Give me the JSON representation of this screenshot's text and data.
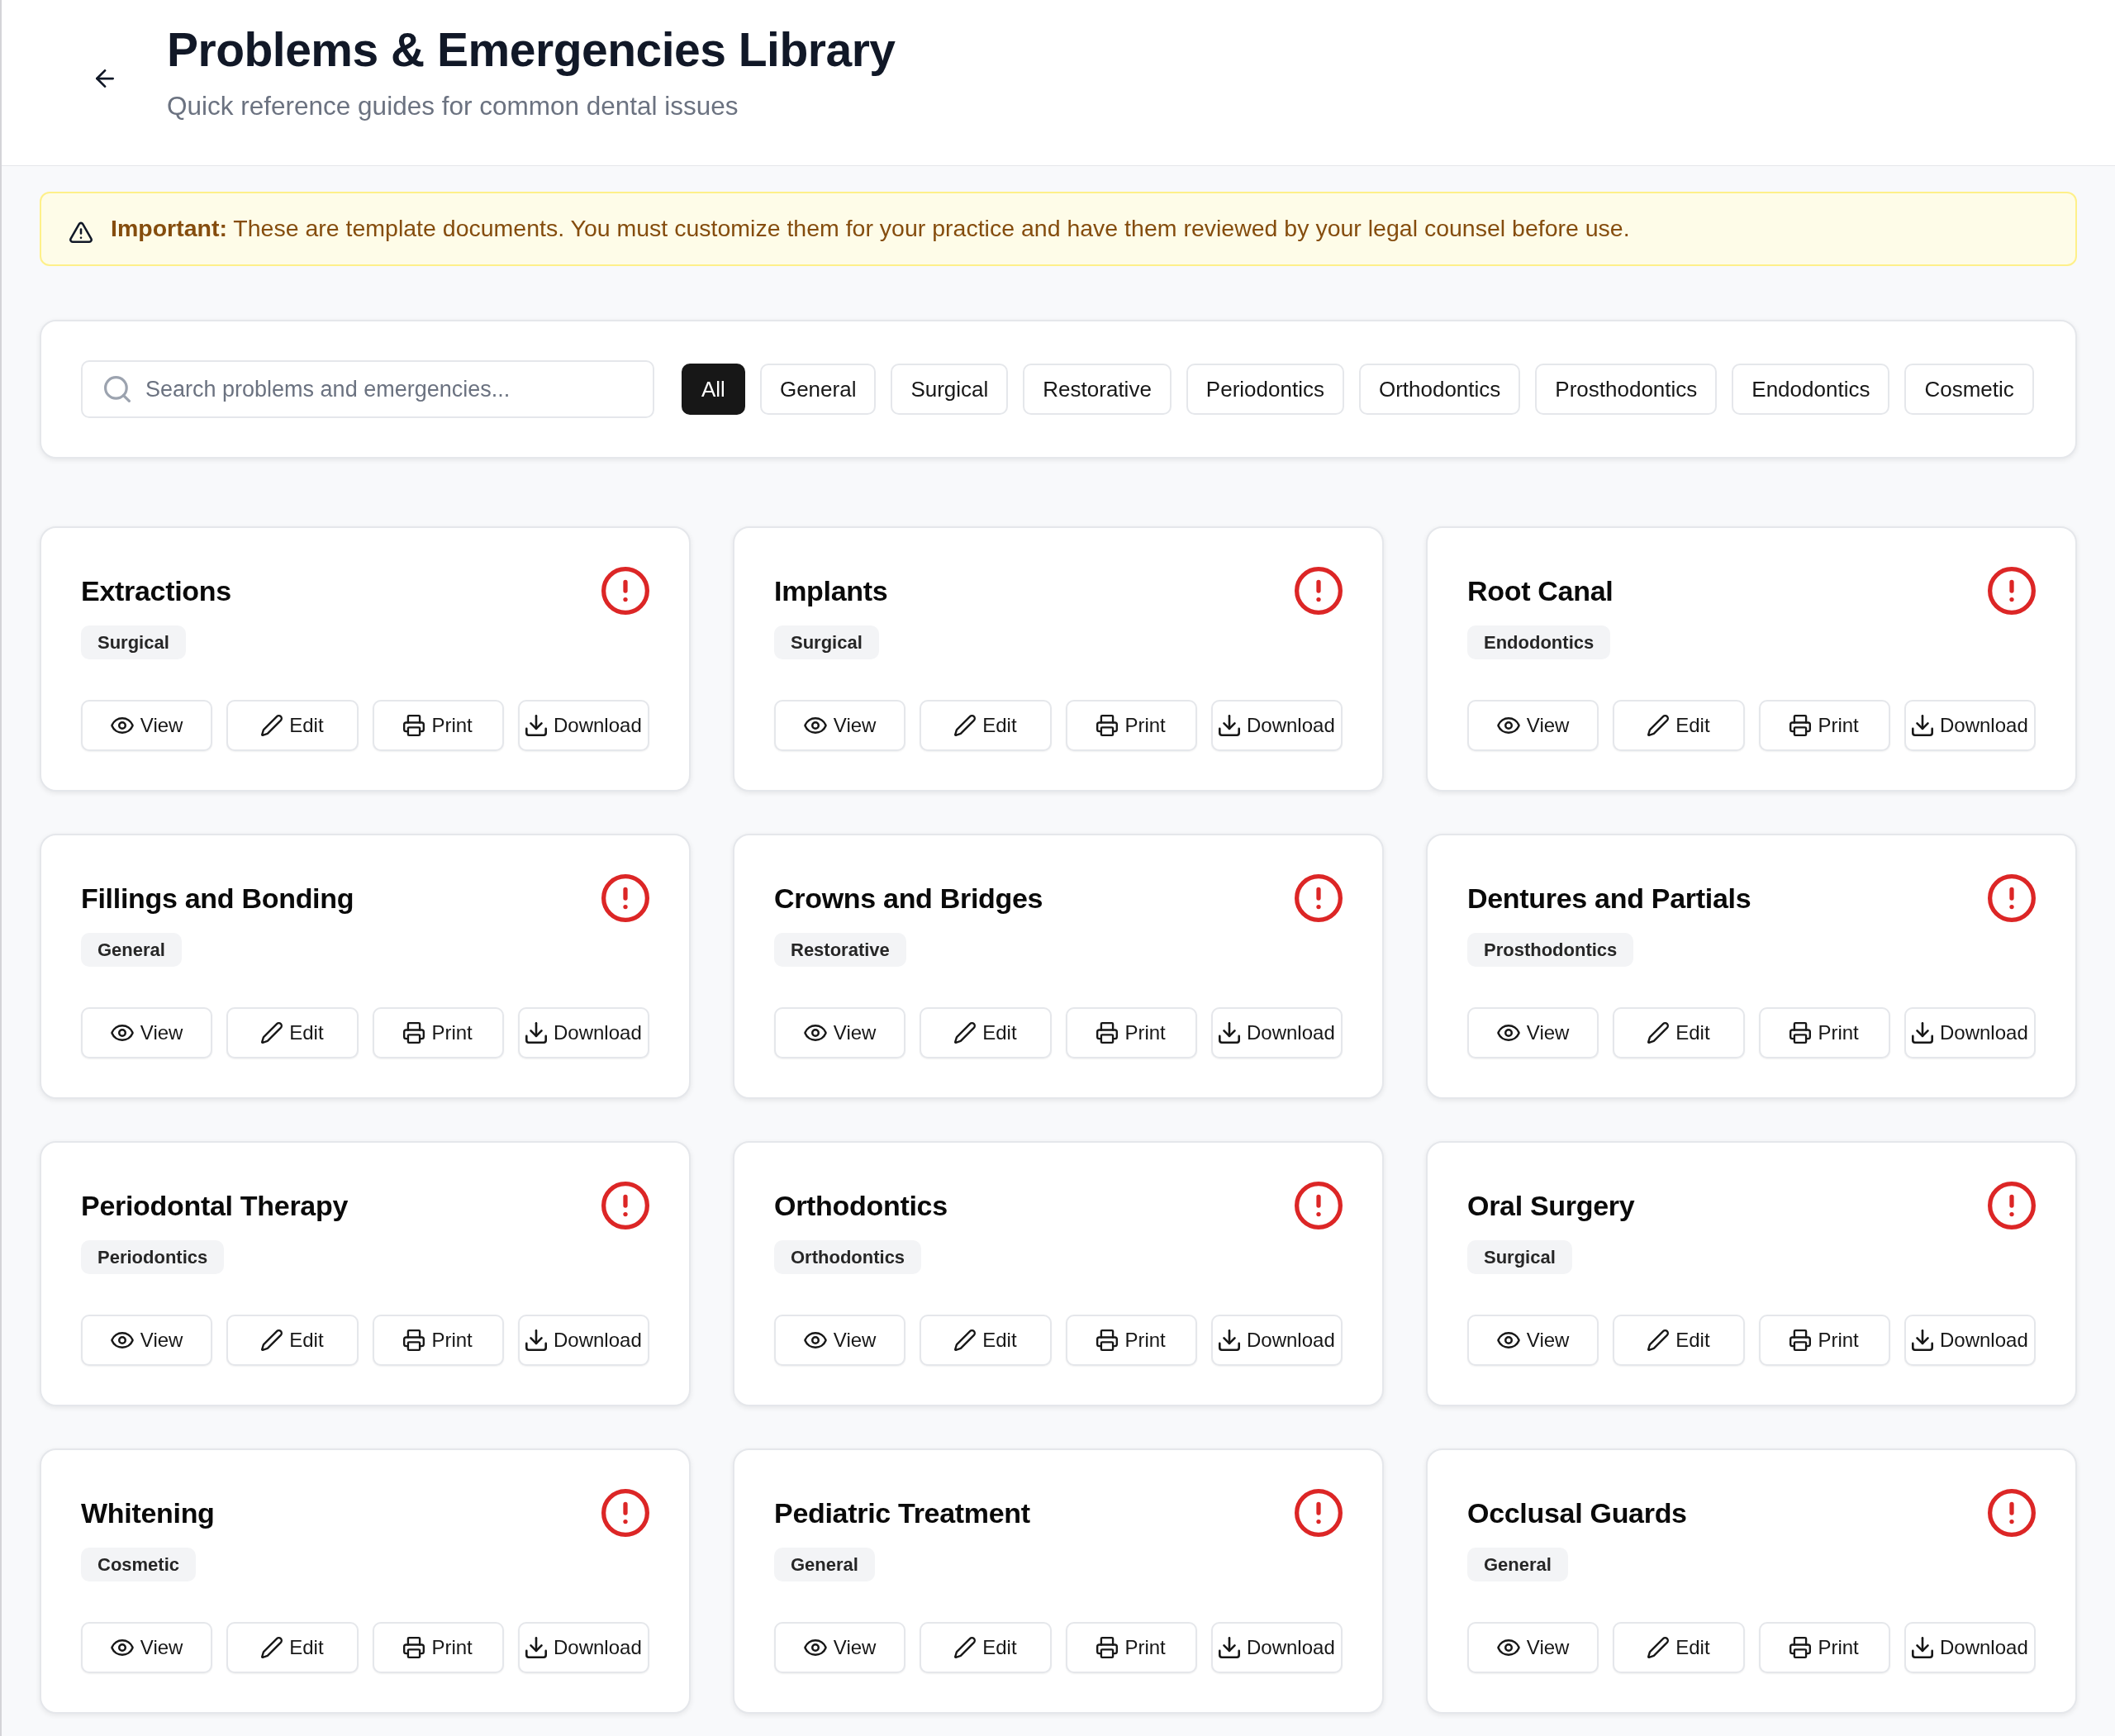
{
  "header": {
    "title": "Problems & Emergencies Library",
    "subtitle": "Quick reference guides for common dental issues"
  },
  "notice": {
    "text": "**Important:** These are template documents. You must customize them for your practice and have them reviewed by your legal counsel before use."
  },
  "search": {
    "placeholder": "Search problems and emergencies..."
  },
  "filters": [
    {
      "label": "All",
      "selected": true
    },
    {
      "label": "General",
      "selected": false
    },
    {
      "label": "Surgical",
      "selected": false
    },
    {
      "label": "Restorative",
      "selected": false
    },
    {
      "label": "Periodontics",
      "selected": false
    },
    {
      "label": "Orthodontics",
      "selected": false
    },
    {
      "label": "Prosthodontics",
      "selected": false
    },
    {
      "label": "Endodontics",
      "selected": false
    },
    {
      "label": "Cosmetic",
      "selected": false
    }
  ],
  "cards": [
    {
      "title": "Extractions",
      "category": "Surgical",
      "actions": [
        {
          "kind": "view",
          "label": "View"
        },
        {
          "kind": "edit",
          "label": "Edit"
        },
        {
          "kind": "print",
          "label": "Print"
        },
        {
          "kind": "download",
          "label": "Download"
        }
      ]
    },
    {
      "title": "Implants",
      "category": "Surgical",
      "actions": [
        {
          "kind": "view",
          "label": "View"
        },
        {
          "kind": "edit",
          "label": "Edit"
        },
        {
          "kind": "print",
          "label": "Print"
        },
        {
          "kind": "download",
          "label": "Download"
        }
      ]
    },
    {
      "title": "Root Canal",
      "category": "Endodontics",
      "actions": [
        {
          "kind": "view",
          "label": "View"
        },
        {
          "kind": "edit",
          "label": "Edit"
        },
        {
          "kind": "print",
          "label": "Print"
        },
        {
          "kind": "download",
          "label": "Download"
        }
      ]
    },
    {
      "title": "Fillings and Bonding",
      "category": "General",
      "actions": [
        {
          "kind": "view",
          "label": "View"
        },
        {
          "kind": "edit",
          "label": "Edit"
        },
        {
          "kind": "print",
          "label": "Print"
        },
        {
          "kind": "download",
          "label": "Download"
        }
      ]
    },
    {
      "title": "Crowns and Bridges",
      "category": "Restorative",
      "actions": [
        {
          "kind": "view",
          "label": "View"
        },
        {
          "kind": "edit",
          "label": "Edit"
        },
        {
          "kind": "print",
          "label": "Print"
        },
        {
          "kind": "download",
          "label": "Download"
        }
      ]
    },
    {
      "title": "Dentures and Partials",
      "category": "Prosthodontics",
      "actions": [
        {
          "kind": "view",
          "label": "View"
        },
        {
          "kind": "edit",
          "label": "Edit"
        },
        {
          "kind": "print",
          "label": "Print"
        },
        {
          "kind": "download",
          "label": "Download"
        }
      ]
    },
    {
      "title": "Periodontal Therapy",
      "category": "Periodontics",
      "actions": [
        {
          "kind": "view",
          "label": "View"
        },
        {
          "kind": "edit",
          "label": "Edit"
        },
        {
          "kind": "print",
          "label": "Print"
        },
        {
          "kind": "download",
          "label": "Download"
        }
      ]
    },
    {
      "title": "Orthodontics",
      "category": "Orthodontics",
      "actions": [
        {
          "kind": "view",
          "label": "View"
        },
        {
          "kind": "edit",
          "label": "Edit"
        },
        {
          "kind": "print",
          "label": "Print"
        },
        {
          "kind": "download",
          "label": "Download"
        }
      ]
    },
    {
      "title": "Oral Surgery",
      "category": "Surgical",
      "actions": [
        {
          "kind": "view",
          "label": "View"
        },
        {
          "kind": "edit",
          "label": "Edit"
        },
        {
          "kind": "print",
          "label": "Print"
        },
        {
          "kind": "download",
          "label": "Download"
        }
      ]
    },
    {
      "title": "Whitening",
      "category": "Cosmetic",
      "actions": [
        {
          "kind": "view",
          "label": "View"
        },
        {
          "kind": "edit",
          "label": "Edit"
        },
        {
          "kind": "print",
          "label": "Print"
        },
        {
          "kind": "download",
          "label": "Download"
        }
      ]
    },
    {
      "title": "Pediatric Treatment",
      "category": "General",
      "actions": [
        {
          "kind": "view",
          "label": "View"
        },
        {
          "kind": "edit",
          "label": "Edit"
        },
        {
          "kind": "print",
          "label": "Print"
        },
        {
          "kind": "download",
          "label": "Download"
        }
      ]
    },
    {
      "title": "Occlusal Guards",
      "category": "General",
      "actions": [
        {
          "kind": "view",
          "label": "View"
        },
        {
          "kind": "edit",
          "label": "Edit"
        },
        {
          "kind": "print",
          "label": "Print"
        },
        {
          "kind": "download",
          "label": "Download"
        }
      ]
    }
  ]
}
